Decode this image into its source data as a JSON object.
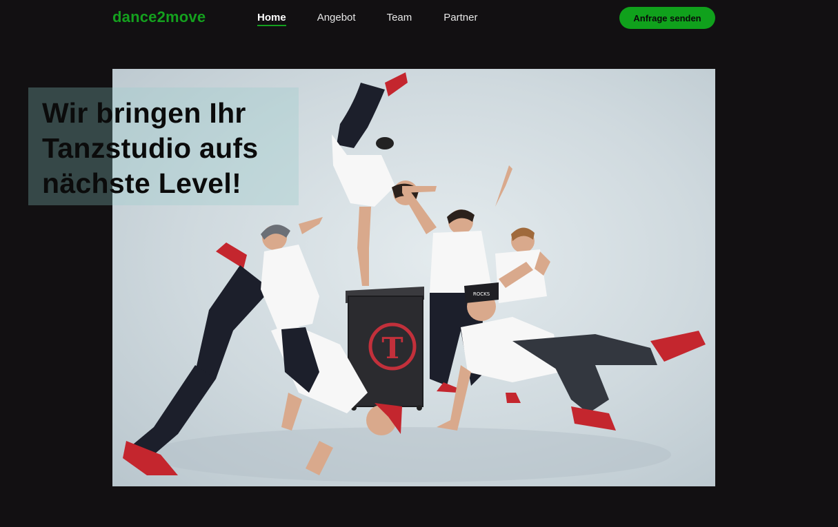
{
  "header": {
    "logo": "dance2move",
    "nav": [
      {
        "label": "Home",
        "active": true
      },
      {
        "label": "Angebot",
        "active": false
      },
      {
        "label": "Team",
        "active": false
      },
      {
        "label": "Partner",
        "active": false
      }
    ],
    "cta_label": "Anfrage senden"
  },
  "hero": {
    "headline": "Wir bringen Ihr Tanzstudio aufs nächste Level!",
    "image_subject": "group of breakdancers posing around a speaker"
  },
  "colors": {
    "background": "#121012",
    "brand_green": "#14a01e",
    "nav_text": "#e8e8e8"
  }
}
